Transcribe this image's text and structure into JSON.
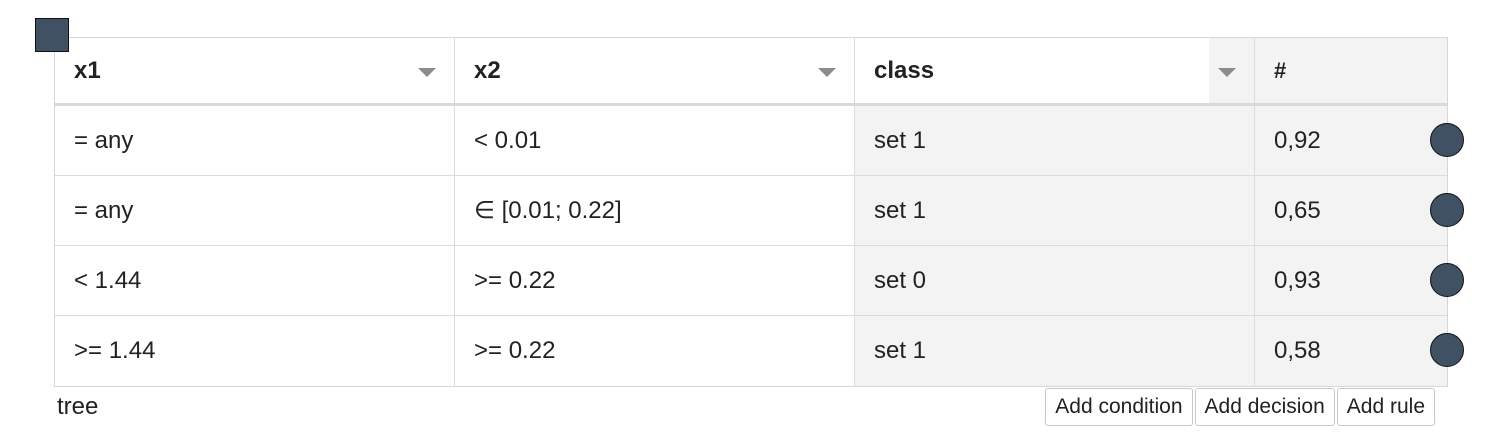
{
  "table": {
    "headers": [
      {
        "key": "x1",
        "label": "x1",
        "dropdown": true
      },
      {
        "key": "x2",
        "label": "x2",
        "dropdown": true
      },
      {
        "key": "class",
        "label": "class",
        "dropdown": true
      },
      {
        "key": "hash",
        "label": "#",
        "dropdown": false
      }
    ],
    "rows": [
      {
        "x1": "= any",
        "x2": "< 0.01",
        "class": "set 1",
        "hash": "0,92"
      },
      {
        "x1": "= any",
        "x2": "∈ [0.01; 0.22]",
        "class": "set 1",
        "hash": "0,65"
      },
      {
        "x1": "< 1.44",
        "x2": ">= 0.22",
        "class": "set 0",
        "hash": "0,93"
      },
      {
        "x1": ">= 1.44",
        "x2": ">= 0.22",
        "class": "set 1",
        "hash": "0,58"
      }
    ]
  },
  "footer": {
    "label": "tree",
    "buttons": {
      "add_condition": "Add condition",
      "add_decision": "Add decision",
      "add_rule": "Add rule"
    }
  },
  "colors": {
    "handle": "#3f5162",
    "shaded_column": "#f3f3f3",
    "border": "#dcdcdc"
  }
}
